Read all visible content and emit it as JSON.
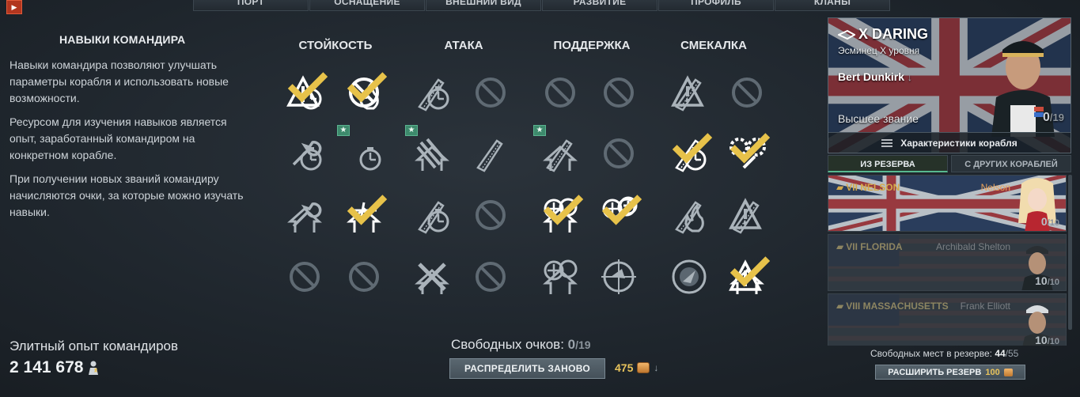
{
  "topnav": {
    "tabs": [
      "ПОРТ",
      "ОСНАЩЕНИЕ",
      "ВНЕШНИЙ ВИД",
      "РАЗВИТИЕ",
      "ПРОФИЛЬ",
      "КЛАНЫ"
    ]
  },
  "info": {
    "title": "НАВЫКИ КОМАНДИРА",
    "p1": "Навыки командира позволяют улучшать параметры корабля и использовать новые возможности.",
    "p2": "Ресурсом для изучения навыков является опыт, заработанный командиром на конкретном корабле.",
    "p3": "При получении новых званий командиру начисляются очки, за которые можно изучать навыки."
  },
  "elite": {
    "label": "Элитный опыт командиров",
    "value": "2 141 678"
  },
  "skill_columns": [
    "СТОЙКОСТЬ",
    "АТАКА",
    "ПОДДЕРЖКА",
    "СМЕКАЛКА"
  ],
  "skills": [
    {
      "icon": "warning-radar-icon",
      "state": "learned"
    },
    {
      "icon": "no-fire-icon",
      "state": "learned"
    },
    {
      "icon": "shells-timer-icon",
      "state": "available"
    },
    {
      "icon": "locked-icon",
      "state": "locked"
    },
    {
      "icon": "locked-icon",
      "state": "locked"
    },
    {
      "icon": "locked-icon",
      "state": "locked"
    },
    {
      "icon": "shell-warning-icon",
      "state": "available"
    },
    {
      "icon": "locked-icon",
      "state": "locked"
    },
    {
      "icon": "wrench-timer-icon",
      "state": "available"
    },
    {
      "icon": "timer-icon",
      "state": "available",
      "star": true
    },
    {
      "icon": "torpedo-launcher-icon",
      "state": "available",
      "star": true
    },
    {
      "icon": "shell-arrow-icon",
      "state": "available"
    },
    {
      "icon": "planes-arrow-icon",
      "state": "available",
      "star": true
    },
    {
      "icon": "locked-icon",
      "state": "locked"
    },
    {
      "icon": "shells-timer-bright-icon",
      "state": "learned"
    },
    {
      "icon": "gears-wrench-icon",
      "state": "learned"
    },
    {
      "icon": "wrench-arrow-icon",
      "state": "available"
    },
    {
      "icon": "ship-plane-arrow-icon",
      "state": "learned"
    },
    {
      "icon": "shells-timer-icon",
      "state": "available"
    },
    {
      "icon": "locked-icon",
      "state": "locked"
    },
    {
      "icon": "aa-arrow-icon",
      "state": "learned"
    },
    {
      "icon": "aa-plus-icon",
      "state": "learned"
    },
    {
      "icon": "shells-fire-icon",
      "state": "available"
    },
    {
      "icon": "shells-warning-icon",
      "state": "available"
    },
    {
      "icon": "locked-icon",
      "state": "locked"
    },
    {
      "icon": "locked-icon",
      "state": "locked"
    },
    {
      "icon": "crossed-shells-arrow-icon",
      "state": "available"
    },
    {
      "icon": "locked-icon",
      "state": "locked"
    },
    {
      "icon": "aa-double-arrow-icon",
      "state": "available"
    },
    {
      "icon": "plane-target-icon",
      "state": "available"
    },
    {
      "icon": "radar-detect-icon",
      "state": "available"
    },
    {
      "icon": "warning-down-icon",
      "state": "learned"
    }
  ],
  "points": {
    "label": "Свободных очков:",
    "value": "0",
    "max": "/19"
  },
  "redistribute": {
    "label": "РАСПРЕДЕЛИТЬ ЗАНОВО",
    "cost": "475"
  },
  "ship": {
    "tier_name": "X DARING",
    "type": "Эсминец X уровня",
    "commander": "Bert Dunkirk",
    "rank": "Высшее звание",
    "points": "0",
    "points_max": "/19",
    "stats_button": "Характеристики корабля"
  },
  "reserve_tabs": [
    "ИЗ РЕЗЕРВА",
    "С ДРУГИХ КОРАБЛЕЙ"
  ],
  "reserve": [
    {
      "ship": "VII NELSON",
      "commander": "Nelson",
      "pts": "0",
      "max": "/10",
      "dim": false
    },
    {
      "ship": "VII FLORIDA",
      "commander": "Archibald Shelton",
      "pts": "10",
      "max": "/10",
      "dim": true
    },
    {
      "ship": "VIII MASSACHUSETTS",
      "commander": "Frank Elliott",
      "pts": "10",
      "max": "/10",
      "dim": true
    }
  ],
  "free_slots": {
    "label": "Свободных мест в резерве:",
    "value": "44",
    "max": "/55"
  },
  "expand": {
    "label": "РАСШИРИТЬ РЕЗЕРВ",
    "cost": "100"
  },
  "colors": {
    "learned_tick": "#e7c24a",
    "star_badge": "#3d8a6c",
    "gold": "#e8c35c"
  }
}
